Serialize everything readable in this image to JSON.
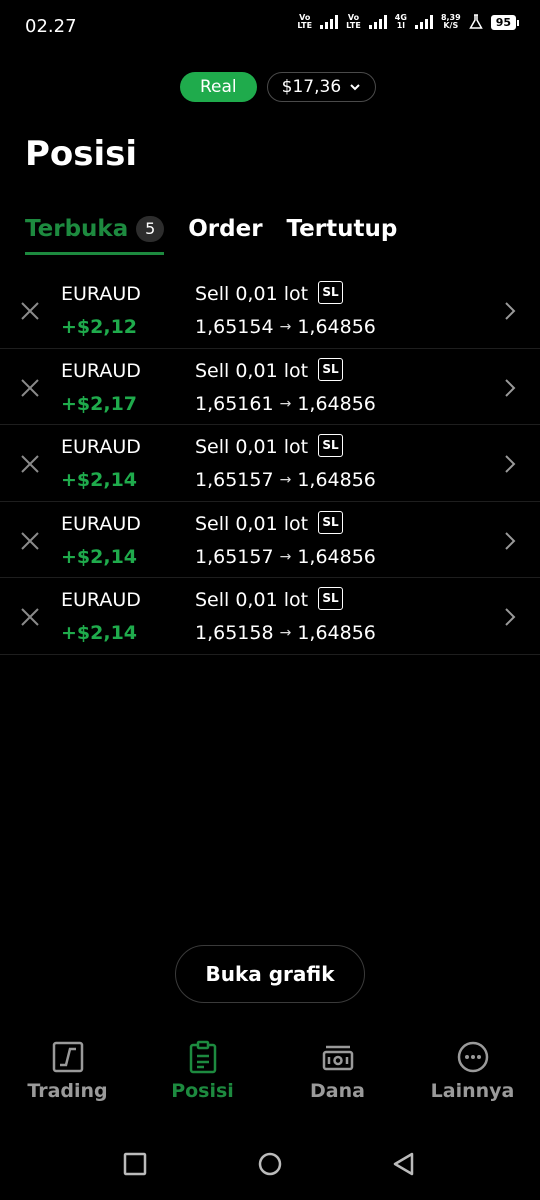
{
  "status_bar": {
    "time": "02.27",
    "sim1_label_top": "Vo",
    "sim1_label_bottom": "LTE",
    "sim2_label_top": "Vo",
    "sim2_label_bottom": "LTE",
    "network_top": "4G",
    "network_bottom": "1l",
    "speed_value": "8,39",
    "speed_unit": "K/S",
    "battery": "95"
  },
  "account": {
    "type": "Real",
    "balance": "$17,36"
  },
  "page_title": "Posisi",
  "tabs": [
    {
      "label": "Terbuka",
      "badge": "5",
      "active": true
    },
    {
      "label": "Order",
      "active": false
    },
    {
      "label": "Tertutup",
      "active": false
    }
  ],
  "positions": [
    {
      "symbol": "EURAUD",
      "pnl": "+$2,12",
      "order": "Sell 0,01 lot",
      "sl": "SL",
      "open_price": "1,65154",
      "arrow": "→",
      "current_price": "1,64856"
    },
    {
      "symbol": "EURAUD",
      "pnl": "+$2,17",
      "order": "Sell 0,01 lot",
      "sl": "SL",
      "open_price": "1,65161",
      "arrow": "→",
      "current_price": "1,64856"
    },
    {
      "symbol": "EURAUD",
      "pnl": "+$2,14",
      "order": "Sell 0,01 lot",
      "sl": "SL",
      "open_price": "1,65157",
      "arrow": "→",
      "current_price": "1,64856"
    },
    {
      "symbol": "EURAUD",
      "pnl": "+$2,14",
      "order": "Sell 0,01 lot",
      "sl": "SL",
      "open_price": "1,65157",
      "arrow": "→",
      "current_price": "1,64856"
    },
    {
      "symbol": "EURAUD",
      "pnl": "+$2,14",
      "order": "Sell 0,01 lot",
      "sl": "SL",
      "open_price": "1,65158",
      "arrow": "→",
      "current_price": "1,64856"
    }
  ],
  "chart_button": "Buka grafik",
  "bottom_nav": [
    {
      "label": "Trading",
      "icon": "chart-icon",
      "active": false
    },
    {
      "label": "Posisi",
      "icon": "clipboard-icon",
      "active": true
    },
    {
      "label": "Dana",
      "icon": "cash-icon",
      "active": false
    },
    {
      "label": "Lainnya",
      "icon": "more-icon",
      "active": false
    }
  ],
  "colors": {
    "accent_green": "#1fab4c",
    "active_tab_green": "#1d8a3f",
    "background": "#000000"
  }
}
